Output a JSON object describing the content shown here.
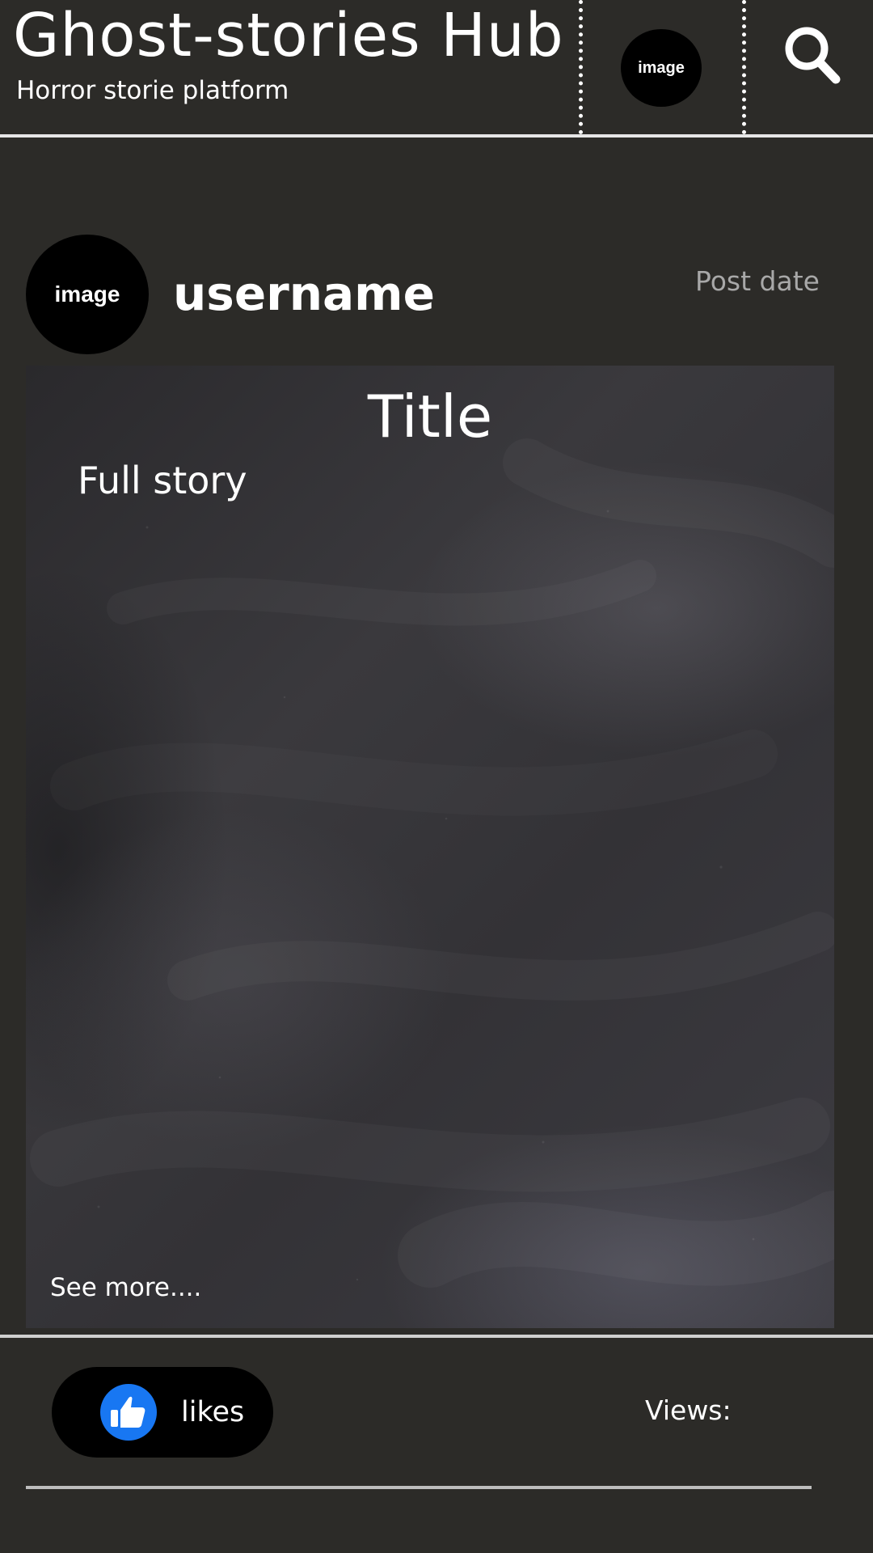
{
  "header": {
    "title": "Ghost-stories Hub",
    "subtitle": "Horror storie platform",
    "avatar_label": "image",
    "search_icon": "search-icon"
  },
  "post": {
    "avatar_label": "image",
    "username": "username",
    "date_label": "Post date",
    "title": "Title",
    "body": "Full story",
    "see_more": "See more....",
    "board_style": "chalkboard"
  },
  "footer": {
    "like_icon": "thumbs-up-icon",
    "likes_label": "likes",
    "views_label": "Views:"
  },
  "colors": {
    "background": "#2c2b28",
    "text": "#ffffff",
    "muted_text": "#a8a8a8",
    "avatar_bg": "#000000",
    "like_blue": "#1877f2"
  }
}
